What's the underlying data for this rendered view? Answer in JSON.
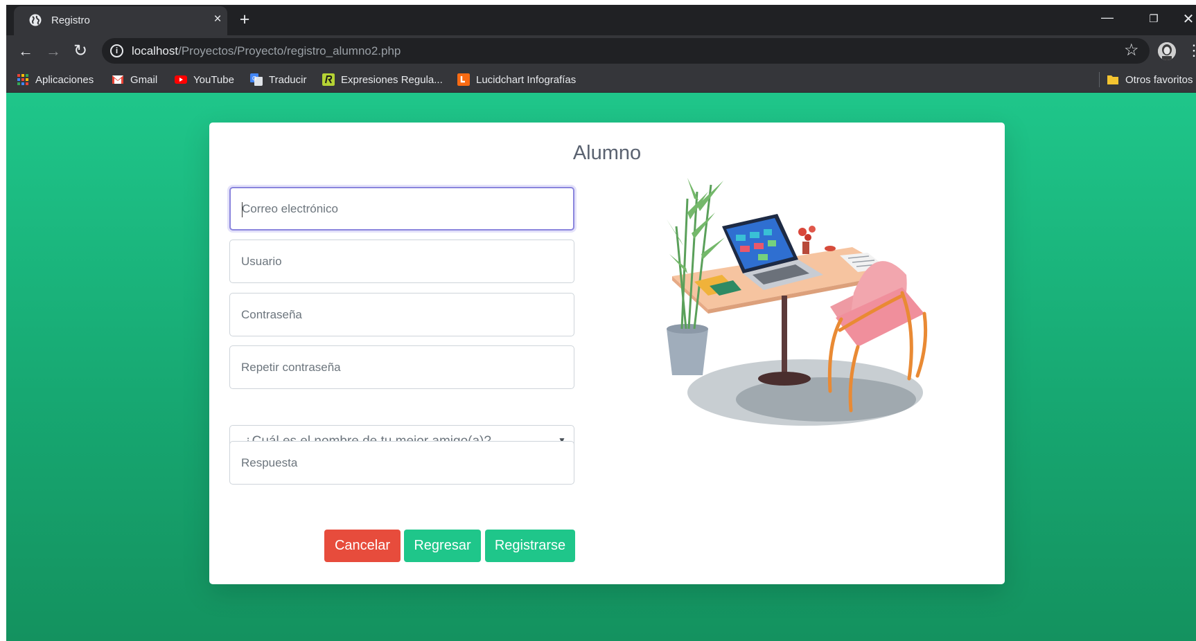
{
  "browser": {
    "tab_title": "Registro",
    "tab_close": "×",
    "new_tab": "+",
    "win_min": "—",
    "win_max": "❐",
    "win_close": "✕",
    "nav_back": "←",
    "nav_forward": "→",
    "nav_reload": "↻",
    "info": "i",
    "url_host": "localhost",
    "url_path": "/Proyectos/Proyecto/registro_alumno2.php",
    "star": "☆",
    "menu": "⋮"
  },
  "bookmarks": [
    {
      "label": "Aplicaciones"
    },
    {
      "label": "Gmail"
    },
    {
      "label": "YouTube"
    },
    {
      "label": "Traducir"
    },
    {
      "label": "Expresiones Regula..."
    },
    {
      "label": "Lucidchart Infografías"
    }
  ],
  "other_bookmarks": "Otros favoritos",
  "form": {
    "title": "Alumno",
    "email_placeholder": "Correo electrónico",
    "user_placeholder": "Usuario",
    "password_placeholder": "Contraseña",
    "repeat_password_placeholder": "Repetir contraseña",
    "question_selected": "¿Cuál es el nombre de tu mejor amigo(a)?",
    "select_arrow": "▼",
    "answer_placeholder": "Respuesta",
    "cancel_label": "Cancelar",
    "back_label": "Regresar",
    "register_label": "Registrarse"
  },
  "colors": {
    "page_gradient_top": "#1fc68a",
    "page_gradient_bottom": "#14925f",
    "cancel": "#e74c3c",
    "primary": "#1fc68a",
    "focus_border": "#8a85dd",
    "chrome_dark": "#202124",
    "chrome_toolbar": "#35363a"
  },
  "icons": [
    "globe-icon",
    "close-icon",
    "plus-icon",
    "back-arrow-icon",
    "forward-arrow-icon",
    "reload-icon",
    "info-icon",
    "star-icon",
    "profile-avatar-icon",
    "kebab-menu-icon",
    "apps-grid-icon",
    "gmail-icon",
    "youtube-icon",
    "google-translate-icon",
    "regex-icon",
    "lucidchart-icon",
    "folder-icon",
    "chevron-down-icon"
  ]
}
